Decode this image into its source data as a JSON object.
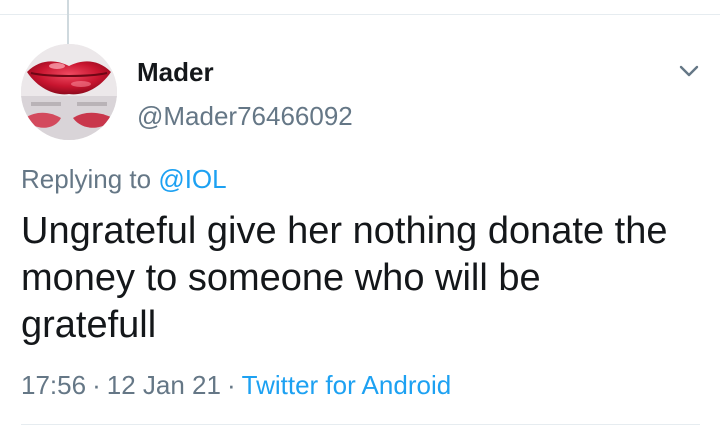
{
  "tweet": {
    "author": {
      "name": "Mader",
      "handle": "@Mader76466092",
      "avatar_icon": "lips-photo-avatar"
    },
    "reply": {
      "prefix": "Replying to",
      "handle": "@IOL"
    },
    "text": "Ungrateful give her nothing donate the money to someone who will be gratefull",
    "meta": {
      "time": "17:56",
      "separator": "·",
      "date": "12 Jan 21",
      "source": "Twitter for Android"
    },
    "menu_icon": "chevron-down-icon"
  },
  "colors": {
    "primary_text": "#14171a",
    "secondary_text": "#657786",
    "link_blue": "#1da1f2",
    "divider": "#e6ecf0"
  }
}
